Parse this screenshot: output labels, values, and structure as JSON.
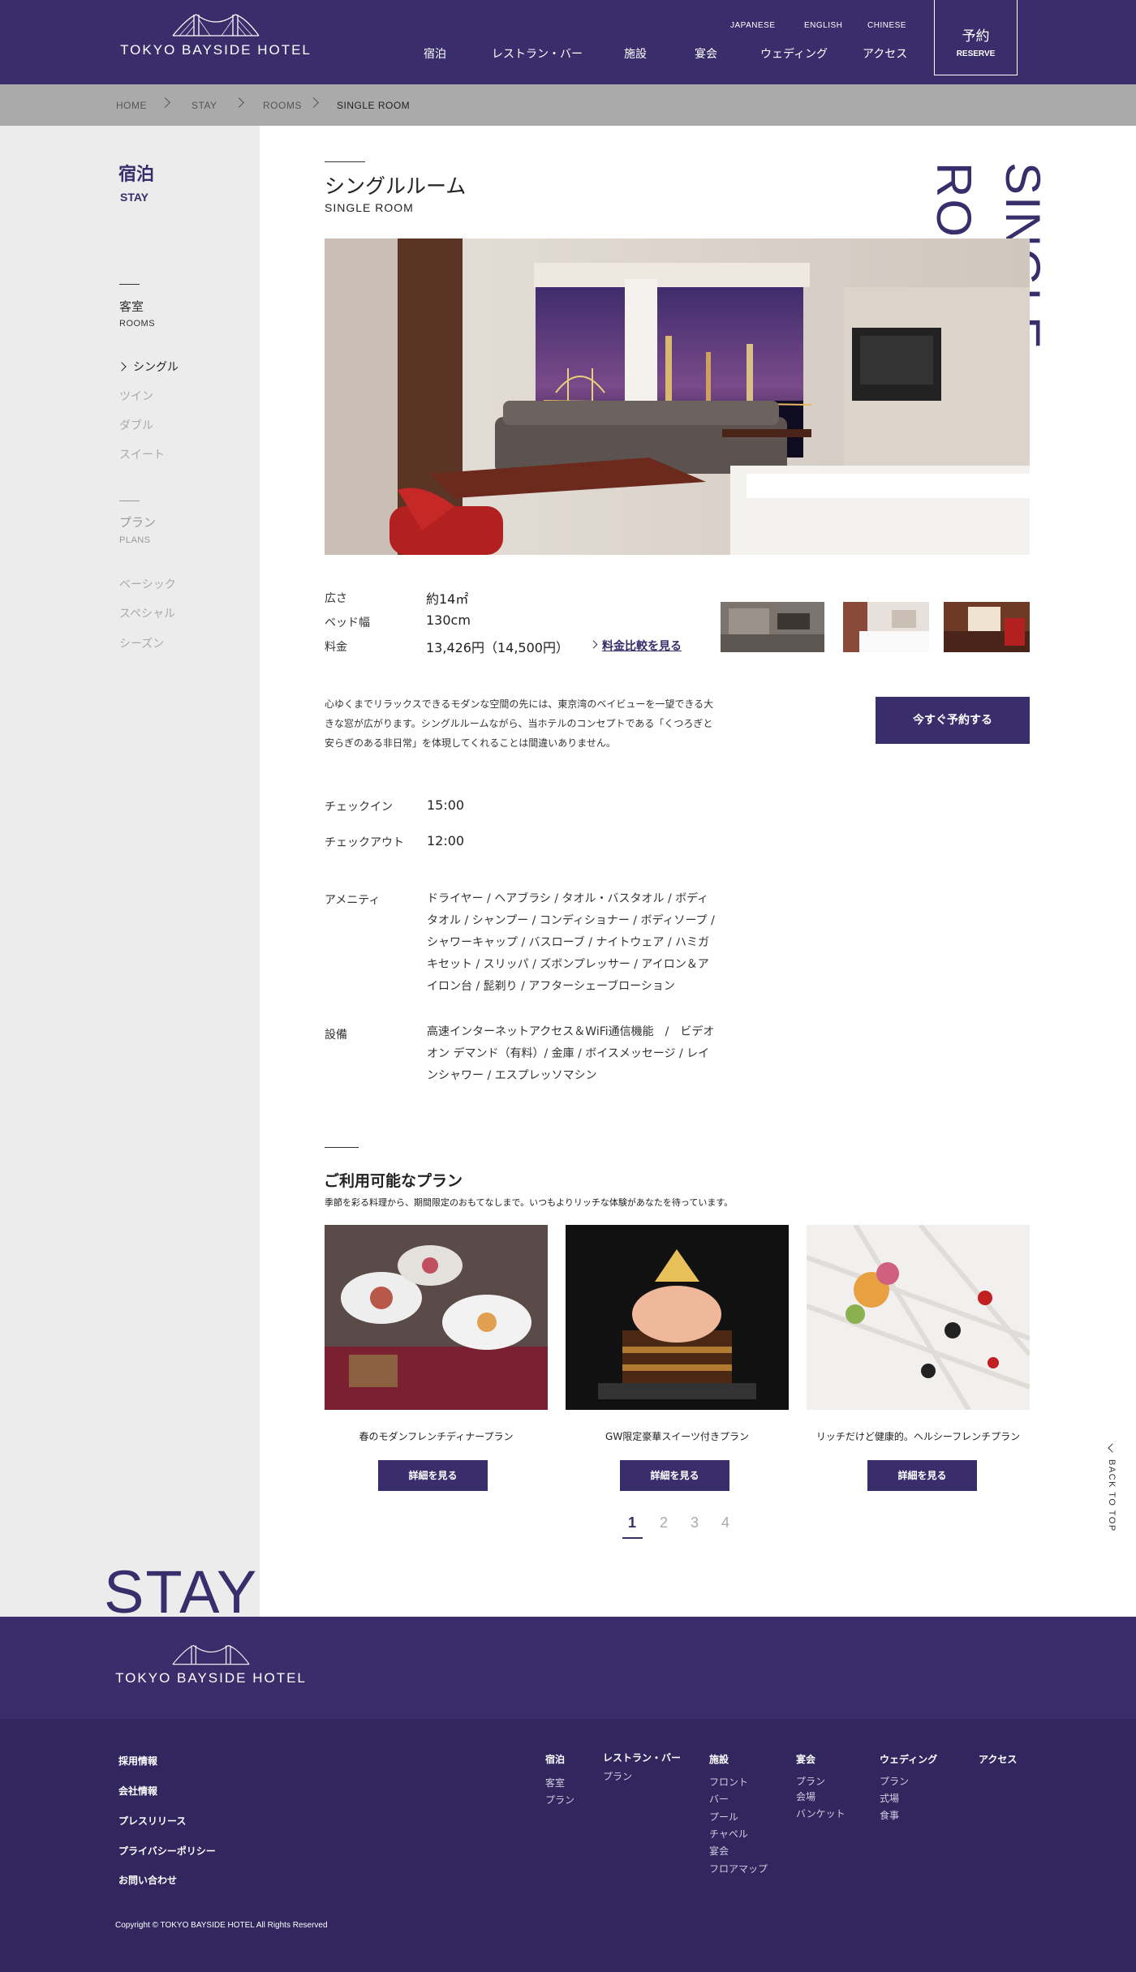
{
  "header": {
    "logo_text": "TOKYO BAYSIDE HOTEL",
    "nav": [
      "宿泊",
      "レストラン・バー",
      "施設",
      "宴会",
      "ウェディング",
      "アクセス"
    ],
    "languages": [
      "JAPANESE",
      "ENGLISH",
      "CHINESE"
    ],
    "reserve_jp": "予約",
    "reserve_en": "RESERVE"
  },
  "breadcrumb": [
    "HOME",
    "STAY",
    "ROOMS",
    "SINGLE ROOM"
  ],
  "sidebar": {
    "title_jp": "宿泊",
    "title_en": "STAY",
    "rooms_jp": "客室",
    "rooms_en": "ROOMS",
    "room_items": [
      "シングル",
      "ツイン",
      "ダブル",
      "スイート"
    ],
    "plans_jp": "プラン",
    "plans_en": "PLANS",
    "plan_items": [
      "ベーシック",
      "スペシャル",
      "シーズン"
    ]
  },
  "room": {
    "vertical_title": [
      "SINGLE",
      "ROOM"
    ],
    "title_jp": "シングルルーム",
    "title_en": "SINGLE ROOM",
    "specs": [
      {
        "label": "広さ",
        "value": "約14㎡"
      },
      {
        "label": "ベッド幅",
        "value": "130cm"
      },
      {
        "label": "料金",
        "value": "13,426円（14,500円）"
      }
    ],
    "compare_link": "料金比較を見る",
    "description": "心ゆくまでリラックスできるモダンな空間の先には、東京湾のベイビューを一望できる大きな窓が広がります。シングルルームながら、当ホテルのコンセプトである「くつろぎと安らぎのある非日常」を体現してくれることは間違いありません。",
    "book_button": "今すぐ予約する",
    "checkin_label": "チェックイン",
    "checkin": "15:00",
    "checkout_label": "チェックアウト",
    "checkout": "12:00",
    "amenity_label": "アメニティ",
    "amenity": "ドライヤー / ヘアブラシ / タオル・バスタオル / ボディタオル / シャンプー / コンディショナー / ボディソープ / シャワーキャップ / バスローブ / ナイトウェア / ハミガキセット  / スリッパ / ズボンプレッサー / アイロン＆アイロン台 / 髭剃り / アフターシェーブローション",
    "equipment_label": "設備",
    "equipment": "高速インターネットアクセス＆WiFi通信機能　/　ビデオオン デマンド（有料）/ 金庫 / ボイスメッセージ / レインシャワー / エスプレッソマシン"
  },
  "plans": {
    "title": "ご利用可能なプラン",
    "subtitle": "季節を彩る料理から、期間限定のおもてなしまで。いつもよりリッチな体験があなたを待っています。",
    "items": [
      {
        "name": "春のモダンフレンチディナープラン",
        "button": "詳細を見る"
      },
      {
        "name": "GW限定豪華スイーツ付きプラン",
        "button": "詳細を見る"
      },
      {
        "name": "リッチだけど健康的。ヘルシーフレンチプラン",
        "button": "詳細を見る"
      }
    ],
    "pages": [
      "1",
      "2",
      "3",
      "4"
    ]
  },
  "back_to_top": "BACK TO TOP",
  "stay_big": "STAY",
  "footer": {
    "logo_text": "TOKYO BAYSIDE HOTEL",
    "links": [
      "採用情報",
      "会社情報",
      "プレスリリース",
      "プライバシーポリシー",
      "お問い合わせ"
    ],
    "columns": [
      {
        "head": "宿泊",
        "items": [
          "客室",
          "プラン"
        ]
      },
      {
        "head": "レストラン・バー",
        "items": [
          "プラン"
        ]
      },
      {
        "head": "施設",
        "items": [
          "フロント",
          "バー",
          "プール",
          "チャペル",
          "宴会",
          "フロアマップ"
        ]
      },
      {
        "head": "宴会",
        "items": [
          "プラン",
          "会場",
          "バンケット"
        ]
      },
      {
        "head": "ウェディング",
        "items": [
          "プラン",
          "式場",
          "食事"
        ]
      },
      {
        "head": "アクセス",
        "items": []
      }
    ],
    "copyright": "Copyright © TOKYO BAYSIDE HOTEL All Rights Reserved"
  },
  "colors": {
    "brand": "#3a2d6b",
    "footer_dark": "#31265d",
    "sidebar_bg": "#ececec",
    "breadcrumb_bg": "#aaaaaa"
  }
}
